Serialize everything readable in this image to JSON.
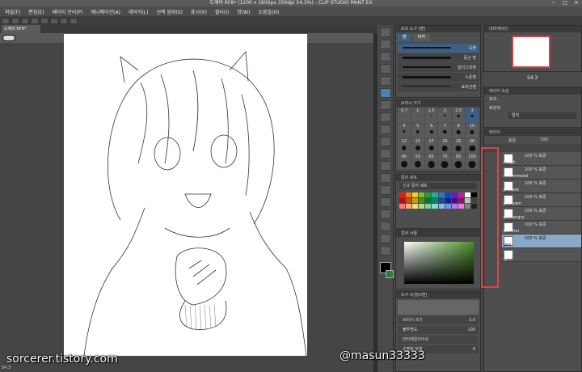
{
  "window": {
    "title": "도깨비 RF8* (1200 x 1600px 350dpi 54.3%) - CLIP STUDIO PAINT EX",
    "controls": [
      "─",
      "□",
      "✕"
    ]
  },
  "menu": [
    "파일(F)",
    "편집(E)",
    "페이지 관리(P)",
    "애니메이션(A)",
    "레이어(L)",
    "선택 범위(S)",
    "표시(V)",
    "필터(I)",
    "창(W)",
    "도움말(H)"
  ],
  "document_tab": "도깨비 RF8*",
  "subtool": {
    "header": "보조 도구 [펜]",
    "tabs": [
      "펜",
      "마커"
    ],
    "items": [
      {
        "label": "G펜"
      },
      {
        "label": "둥근 펜"
      },
      {
        "label": "밀리그라펜"
      },
      {
        "label": "스푼펜"
      },
      {
        "label": "효과선펜"
      }
    ]
  },
  "brush_size": {
    "header": "브러시 크기",
    "sizes": [
      "0.7",
      "1",
      "1.5",
      "2",
      "2.5",
      "3",
      "4",
      "5",
      "6",
      "7",
      "8",
      "10",
      "12",
      "15",
      "17",
      "20",
      "25",
      "30",
      "40",
      "50",
      "60",
      "70",
      "80",
      "100"
    ],
    "selected": "3"
  },
  "color_set": {
    "header": "컬러 세트",
    "set_name": "신규 컬러 세트",
    "colors": [
      "#e02020",
      "#f07a20",
      "#f0d020",
      "#80c020",
      "#20a040",
      "#20b0a0",
      "#2080d0",
      "#2040c0",
      "#6020b0",
      "#c020a0",
      "#ffffff",
      "#000000",
      "#b01010",
      "#c05010",
      "#c0a010",
      "#509010",
      "#107030",
      "#108070",
      "#1050a0",
      "#102090",
      "#401080",
      "#901070",
      "#c0c0c0",
      "#404040",
      "#f08080",
      "#f0b080",
      "#f0e080",
      "#b0e080",
      "#80d0a0",
      "#80e0d0",
      "#80c0f0",
      "#8090e0",
      "#b080e0",
      "#e080d0",
      "#808080",
      "#202020"
    ]
  },
  "color_picker": {
    "header": "컬러 서클"
  },
  "tool_property": {
    "header": "도구 속성[G펜]",
    "rows": [
      {
        "label": "브러시 크기",
        "value": "3.0"
      },
      {
        "label": "불투명도",
        "value": "100"
      },
      {
        "label": "안티에일리어싱",
        "value": ""
      },
      {
        "label": "손떨림 보정",
        "value": "6"
      }
    ]
  },
  "navigator": {
    "header": "내비게이터",
    "zoom": "54.3"
  },
  "layer_property": {
    "header": "레이어 속성",
    "effect": "효과",
    "expression_color": "표현색",
    "color_value": "컬러"
  },
  "layers": {
    "header": "레이어",
    "blend_mode": "표준",
    "opacity": "100",
    "items": [
      {
        "mode": "100 % 표준",
        "name": "rough",
        "selected": false
      },
      {
        "mode": "100 % 표준",
        "name": "recommend",
        "selected": false
      },
      {
        "mode": "100 % 표준",
        "name": "present",
        "selected": false
      },
      {
        "mode": "100 % 표준",
        "name": "pen yam",
        "selected": false
      },
      {
        "mode": "100 % 표준",
        "name": "pen angry",
        "selected": false
      },
      {
        "mode": "100 % 표준",
        "name": "pen fun",
        "selected": false
      },
      {
        "mode": "100 % 표준",
        "name": "pen",
        "selected": true
      },
      {
        "mode": "",
        "name": "용지",
        "selected": false
      }
    ]
  },
  "watermark_left": "sorcerer.tistory.com",
  "watermark_right": "@masun33333",
  "status": "54.3"
}
